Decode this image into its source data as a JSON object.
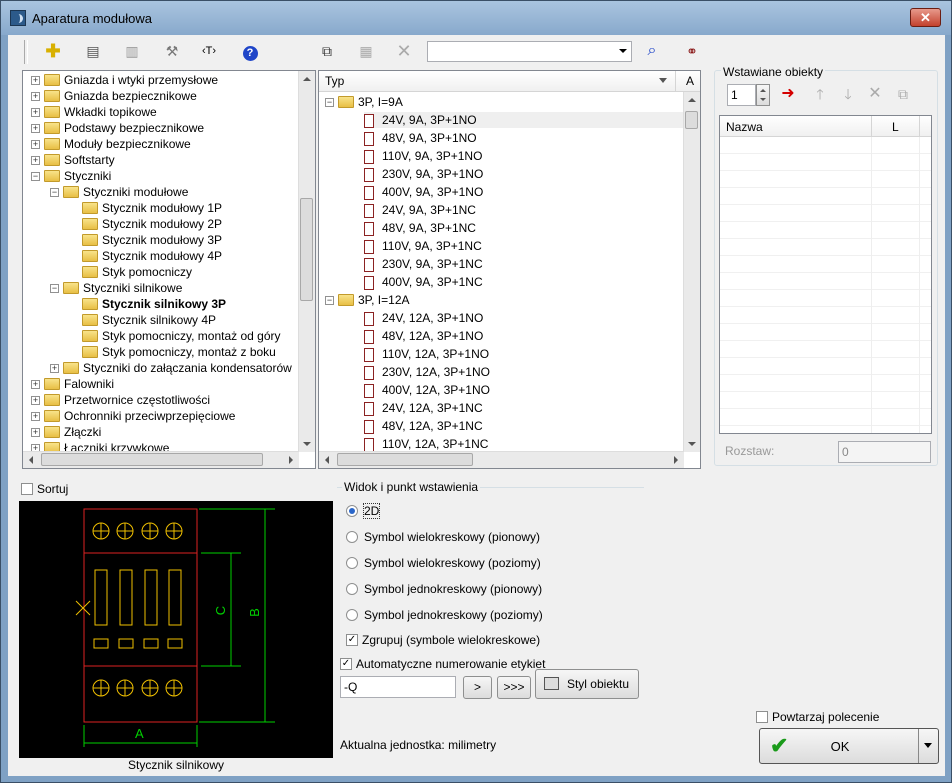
{
  "window": {
    "title": "Aparatura modułowa"
  },
  "toolbar": {
    "search_value": "",
    "icons": [
      "add-icon",
      "properties-icon",
      "list-icon",
      "tools-icon",
      "text-tag-icon",
      "help-icon",
      "copy-icon",
      "table-icon",
      "delete-icon",
      "search-icon",
      "binoculars-icon"
    ]
  },
  "tree": {
    "items": [
      {
        "label": "Gniazda i wtyki przemysłowe",
        "level": 0,
        "exp": "+"
      },
      {
        "label": "Gniazda bezpiecznikowe",
        "level": 0,
        "exp": "+"
      },
      {
        "label": "Wkładki topikowe",
        "level": 0,
        "exp": "+"
      },
      {
        "label": "Podstawy bezpiecznikowe",
        "level": 0,
        "exp": "+"
      },
      {
        "label": "Moduły bezpiecznikowe",
        "level": 0,
        "exp": "+"
      },
      {
        "label": "Softstarty",
        "level": 0,
        "exp": "+"
      },
      {
        "label": "Styczniki",
        "level": 0,
        "exp": "−"
      },
      {
        "label": "Styczniki modułowe",
        "level": 1,
        "exp": "−"
      },
      {
        "label": "Stycznik modułowy 1P",
        "level": 2,
        "exp": ""
      },
      {
        "label": "Stycznik modułowy 2P",
        "level": 2,
        "exp": ""
      },
      {
        "label": "Stycznik modułowy 3P",
        "level": 2,
        "exp": ""
      },
      {
        "label": "Stycznik modułowy 4P",
        "level": 2,
        "exp": ""
      },
      {
        "label": "Styk pomocniczy",
        "level": 2,
        "exp": ""
      },
      {
        "label": "Styczniki silnikowe",
        "level": 1,
        "exp": "−"
      },
      {
        "label": "Stycznik silnikowy 3P",
        "level": 2,
        "exp": "",
        "selected": true
      },
      {
        "label": "Stycznik silnikowy 4P",
        "level": 2,
        "exp": ""
      },
      {
        "label": "Styk pomocniczy, montaż od góry",
        "level": 2,
        "exp": ""
      },
      {
        "label": "Styk pomocniczy, montaż z boku",
        "level": 2,
        "exp": ""
      },
      {
        "label": "Styczniki do załączania kondensatorów",
        "level": 1,
        "exp": "+"
      },
      {
        "label": "Falowniki",
        "level": 0,
        "exp": "+"
      },
      {
        "label": "Przetwornice częstotliwości",
        "level": 0,
        "exp": "+"
      },
      {
        "label": "Ochronniki przeciwprzepięciowe",
        "level": 0,
        "exp": "+"
      },
      {
        "label": "Złączki",
        "level": 0,
        "exp": "+"
      },
      {
        "label": "Łączniki krzywkowe",
        "level": 0,
        "exp": "+"
      }
    ]
  },
  "list": {
    "header": "Typ",
    "header2": "A",
    "items": [
      {
        "label": "3P, I=9A",
        "group": true
      },
      {
        "label": "24V, 9A, 3P+1NO"
      },
      {
        "label": "48V, 9A, 3P+1NO"
      },
      {
        "label": "110V, 9A, 3P+1NO"
      },
      {
        "label": "230V, 9A, 3P+1NO"
      },
      {
        "label": "400V, 9A, 3P+1NO"
      },
      {
        "label": "24V, 9A, 3P+1NC"
      },
      {
        "label": "48V, 9A, 3P+1NC"
      },
      {
        "label": "110V, 9A, 3P+1NC"
      },
      {
        "label": "230V, 9A, 3P+1NC"
      },
      {
        "label": "400V, 9A, 3P+1NC"
      },
      {
        "label": "3P, I=12A",
        "group": true
      },
      {
        "label": "24V, 12A, 3P+1NO"
      },
      {
        "label": "48V, 12A, 3P+1NO"
      },
      {
        "label": "110V, 12A, 3P+1NO"
      },
      {
        "label": "230V, 12A, 3P+1NO"
      },
      {
        "label": "400V, 12A, 3P+1NO"
      },
      {
        "label": "24V, 12A, 3P+1NC"
      },
      {
        "label": "48V, 12A, 3P+1NC"
      },
      {
        "label": "110V, 12A, 3P+1NC"
      }
    ]
  },
  "insert": {
    "group_label": "Wstawiane obiekty",
    "count": "1",
    "col_name": "Nazwa",
    "col_l": "L",
    "spacing_label": "Rozstaw:",
    "spacing_value": "0"
  },
  "preview": {
    "sort_label": "Sortuj",
    "caption": "Stycznik silnikowy",
    "dim_a": "A",
    "dim_b": "B",
    "dim_c": "C"
  },
  "view": {
    "group_label": "Widok i punkt wstawienia",
    "options": [
      {
        "label": "2D",
        "checked": true
      },
      {
        "label": "Symbol wielokreskowy (pionowy)",
        "checked": false
      },
      {
        "label": "Symbol wielokreskowy (poziomy)",
        "checked": false
      },
      {
        "label": "Symbol jednokreskowy (pionowy)",
        "checked": false
      },
      {
        "label": "Symbol jednokreskowy (poziomy)",
        "checked": false
      }
    ],
    "group_chk": "Zgrupuj (symbole wielokreskowe)",
    "autonum_chk": "Automatyczne numerowanie etykiet",
    "prefix_value": "-Q",
    "next_btn": ">",
    "all_btn": ">>>",
    "style_btn": "Styl obiektu",
    "unit_text": "Aktualna jednostka: milimetry"
  },
  "footer": {
    "repeat_label": "Powtarzaj polecenie",
    "ok_label": "OK"
  }
}
